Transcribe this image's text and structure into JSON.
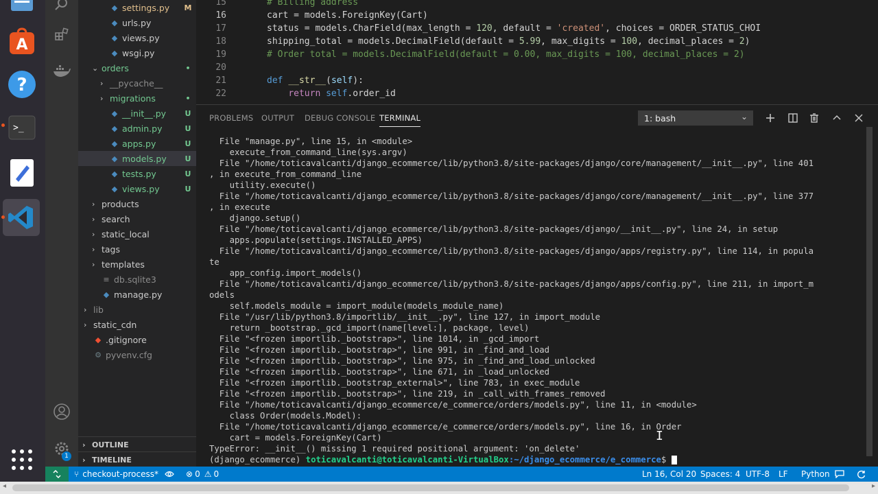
{
  "colors": {
    "dock_bg": "#2d2b33",
    "activity_bg": "#333333",
    "sidebar_bg": "#252526",
    "editor_bg": "#1e1e1e",
    "status_bg": "#007acc",
    "remote_bg": "#16825d",
    "untracked_green": "#73c991",
    "modified_yellow": "#e2c08d",
    "ignored_gray": "#8c8c8c",
    "terminal_prompt_green": "#23d18b",
    "terminal_path_blue": "#3b8eea"
  },
  "dock": {
    "items": [
      {
        "icon": "files-app-icon"
      },
      {
        "icon": "software-center-icon"
      },
      {
        "icon": "help-icon"
      },
      {
        "icon": "terminal-app-icon"
      },
      {
        "icon": "text-editor-icon"
      },
      {
        "icon": "vscode-app-icon"
      },
      {
        "icon": "show-applications-icon"
      }
    ]
  },
  "activity_bar": {
    "icons": [
      "search-icon",
      "extensions-icon",
      "docker-icon",
      "account-icon",
      "settings-gear-icon"
    ],
    "settings_badge": "1"
  },
  "explorer": {
    "items": [
      {
        "label": "settings.py",
        "depth": 2,
        "kind": "file",
        "badge": "M",
        "color": "#e2c08d"
      },
      {
        "label": "urls.py",
        "depth": 2,
        "kind": "file",
        "badge": "",
        "color": "#cccccc"
      },
      {
        "label": "views.py",
        "depth": 2,
        "kind": "file",
        "badge": "",
        "color": "#cccccc"
      },
      {
        "label": "wsgi.py",
        "depth": 2,
        "kind": "file",
        "badge": "",
        "color": "#cccccc"
      },
      {
        "label": "orders",
        "depth": 1,
        "kind": "folder-open",
        "badge": "•",
        "color": "#73c991"
      },
      {
        "label": "__pycache__",
        "depth": 2,
        "kind": "folder",
        "badge": "",
        "color": "#8c8c8c"
      },
      {
        "label": "migrations",
        "depth": 2,
        "kind": "folder",
        "badge": "•",
        "color": "#73c991"
      },
      {
        "label": "__init__.py",
        "depth": 2,
        "kind": "file",
        "badge": "U",
        "color": "#73c991"
      },
      {
        "label": "admin.py",
        "depth": 2,
        "kind": "file",
        "badge": "U",
        "color": "#73c991"
      },
      {
        "label": "apps.py",
        "depth": 2,
        "kind": "file",
        "badge": "U",
        "color": "#73c991"
      },
      {
        "label": "models.py",
        "depth": 2,
        "kind": "file",
        "badge": "U",
        "color": "#73c991",
        "selected": true
      },
      {
        "label": "tests.py",
        "depth": 2,
        "kind": "file",
        "badge": "U",
        "color": "#73c991"
      },
      {
        "label": "views.py",
        "depth": 2,
        "kind": "file",
        "badge": "U",
        "color": "#73c991"
      },
      {
        "label": "products",
        "depth": 1,
        "kind": "folder",
        "badge": "",
        "color": "#cccccc"
      },
      {
        "label": "search",
        "depth": 1,
        "kind": "folder",
        "badge": "",
        "color": "#cccccc"
      },
      {
        "label": "static_local",
        "depth": 1,
        "kind": "folder",
        "badge": "",
        "color": "#cccccc"
      },
      {
        "label": "tags",
        "depth": 1,
        "kind": "folder",
        "badge": "",
        "color": "#cccccc"
      },
      {
        "label": "templates",
        "depth": 1,
        "kind": "folder",
        "badge": "",
        "color": "#cccccc"
      },
      {
        "label": "db.sqlite3",
        "depth": 1,
        "kind": "db",
        "badge": "",
        "color": "#8c8c8c"
      },
      {
        "label": "manage.py",
        "depth": 1,
        "kind": "file",
        "badge": "",
        "color": "#cccccc"
      },
      {
        "label": "lib",
        "depth": 0,
        "kind": "folder",
        "badge": "",
        "color": "#8c8c8c"
      },
      {
        "label": "static_cdn",
        "depth": 0,
        "kind": "folder",
        "badge": "",
        "color": "#cccccc"
      },
      {
        "label": ".gitignore",
        "depth": 0,
        "kind": "git",
        "badge": "",
        "color": "#cccccc"
      },
      {
        "label": "pyvenv.cfg",
        "depth": 0,
        "kind": "cfg",
        "badge": "",
        "color": "#8c8c8c"
      }
    ],
    "outline_label": "OUTLINE",
    "timeline_label": "TIMELINE"
  },
  "editor": {
    "lines": [
      {
        "n": "15",
        "tokens": [
          [
            "# Billing address",
            "#6a9955"
          ]
        ]
      },
      {
        "n": "16",
        "current": true,
        "tokens": [
          [
            "cart = models.ForeignKey(Cart)",
            "#d4d4d4"
          ]
        ]
      },
      {
        "n": "17",
        "tokens": [
          [
            "status = models.CharField(max_length = ",
            "#d4d4d4"
          ],
          [
            "120",
            "#b5cea8"
          ],
          [
            ", default = ",
            "#d4d4d4"
          ],
          [
            "'created'",
            "#ce9178"
          ],
          [
            ", choices = ORDER_STATUS_CHOI",
            "#d4d4d4"
          ]
        ]
      },
      {
        "n": "18",
        "tokens": [
          [
            "shipping_total = models.DecimalField(default = ",
            "#d4d4d4"
          ],
          [
            "5.99",
            "#b5cea8"
          ],
          [
            ", max_digits = ",
            "#d4d4d4"
          ],
          [
            "100",
            "#b5cea8"
          ],
          [
            ", decimal_places = ",
            "#d4d4d4"
          ],
          [
            "2",
            "#b5cea8"
          ],
          [
            ")",
            "#d4d4d4"
          ]
        ]
      },
      {
        "n": "19",
        "tokens": [
          [
            "# Order total = models.DecimalField(default = 0.00, max_digits = 100, decimal_places = 2)",
            "#6a9955"
          ]
        ]
      },
      {
        "n": "20",
        "tokens": []
      },
      {
        "n": "21",
        "tokens": [
          [
            "def",
            "#569cd6"
          ],
          [
            " ",
            "#d4d4d4"
          ],
          [
            "__str__",
            "#dcdcaa"
          ],
          [
            "(",
            "#d4d4d4"
          ],
          [
            "self",
            "#9cdcfe"
          ],
          [
            "):",
            "#d4d4d4"
          ]
        ]
      },
      {
        "n": "22",
        "tokens": [
          [
            "    ",
            "#d4d4d4"
          ],
          [
            "return",
            "#c586c0"
          ],
          [
            " ",
            "#d4d4d4"
          ],
          [
            "self",
            "#569cd6"
          ],
          [
            ".order_id",
            "#d4d4d4"
          ]
        ]
      }
    ]
  },
  "panel": {
    "tabs": [
      "PROBLEMS",
      "OUTPUT",
      "DEBUG CONSOLE",
      "TERMINAL"
    ],
    "active_tab": "TERMINAL",
    "terminal_select": "1: bash"
  },
  "terminal": {
    "lines": [
      "  File \"manage.py\", line 15, in <module>",
      "    execute_from_command_line(sys.argv)",
      "  File \"/home/toticavalcanti/django_ecommerce/lib/python3.8/site-packages/django/core/management/__init__.py\", line 401",
      ", in execute_from_command_line",
      "    utility.execute()",
      "  File \"/home/toticavalcanti/django_ecommerce/lib/python3.8/site-packages/django/core/management/__init__.py\", line 377",
      ", in execute",
      "    django.setup()",
      "  File \"/home/toticavalcanti/django_ecommerce/lib/python3.8/site-packages/django/__init__.py\", line 24, in setup",
      "    apps.populate(settings.INSTALLED_APPS)",
      "  File \"/home/toticavalcanti/django_ecommerce/lib/python3.8/site-packages/django/apps/registry.py\", line 114, in popula",
      "te",
      "    app_config.import_models()",
      "  File \"/home/toticavalcanti/django_ecommerce/lib/python3.8/site-packages/django/apps/config.py\", line 211, in import_m",
      "odels",
      "    self.models_module = import_module(models_module_name)",
      "  File \"/usr/lib/python3.8/importlib/__init__.py\", line 127, in import_module",
      "    return _bootstrap._gcd_import(name[level:], package, level)",
      "  File \"<frozen importlib._bootstrap>\", line 1014, in _gcd_import",
      "  File \"<frozen importlib._bootstrap>\", line 991, in _find_and_load",
      "  File \"<frozen importlib._bootstrap>\", line 975, in _find_and_load_unlocked",
      "  File \"<frozen importlib._bootstrap>\", line 671, in _load_unlocked",
      "  File \"<frozen importlib._bootstrap_external>\", line 783, in exec_module",
      "  File \"<frozen importlib._bootstrap>\", line 219, in _call_with_frames_removed",
      "  File \"/home/toticavalcanti/django_ecommerce/e_commerce/orders/models.py\", line 11, in <module>",
      "    class Order(models.Model):",
      "  File \"/home/toticavalcanti/django_ecommerce/e_commerce/orders/models.py\", line 16, in Order",
      "    cart = models.ForeignKey(Cart)",
      "TypeError: __init__() missing 1 required positional argument: 'on_delete'"
    ],
    "prompt_env": "(django_ecommerce) ",
    "prompt_user": "toticavalcanti@toticavalcanti-VirtualBox",
    "prompt_path": ":~/django_ecommerce/e_commerce",
    "prompt_symbol": "$ "
  },
  "status_bar": {
    "branch": "checkout-process*",
    "errors": "0",
    "warnings": "0",
    "position": "Ln 16, Col 20",
    "spaces": "Spaces: 4",
    "encoding": "UTF-8",
    "eol": "LF",
    "language": "Python"
  }
}
